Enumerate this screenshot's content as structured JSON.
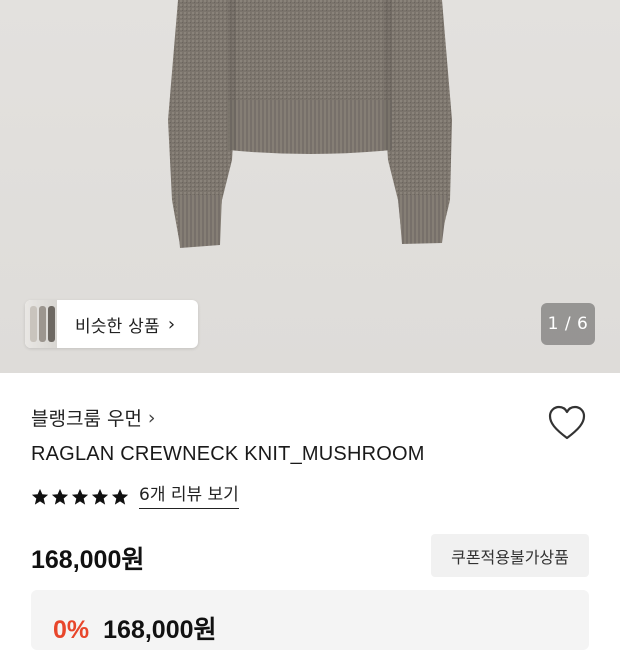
{
  "gallery": {
    "counter": "1 / 6",
    "similar_button_label": "비슷한 상품",
    "chevron_icon": "chevron-right-icon"
  },
  "product": {
    "brand": "블랭크룸 우먼",
    "brand_chevron": "›",
    "name": "RAGLAN CREWNECK KNIT_MUSHROOM",
    "rating_stars": 5,
    "review_link": "6개 리뷰 보기",
    "price": "168,000원",
    "coupon_badge": "쿠폰적용불가상품",
    "discount_rate": "0%",
    "discount_price": "168,000원",
    "wishlist_icon": "heart-outline-icon"
  },
  "colors": {
    "discount_red": "#e8462b",
    "badge_bg": "#f1f1f1",
    "sweater": "#7d756d"
  }
}
